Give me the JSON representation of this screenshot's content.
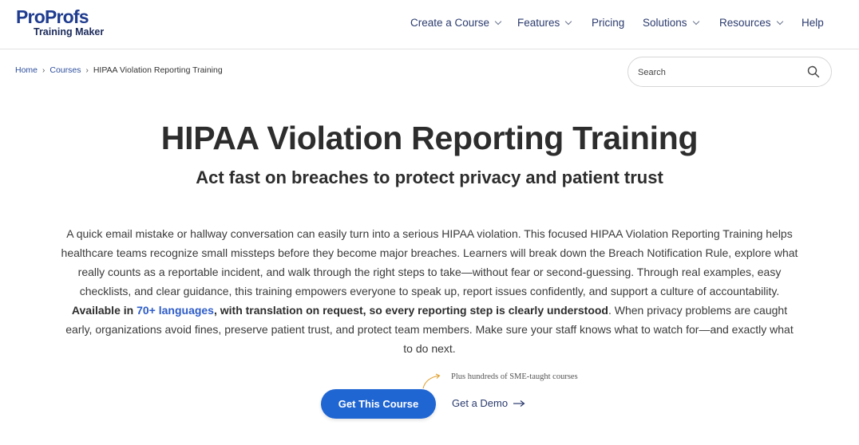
{
  "logo": {
    "top": "ProProfs",
    "sub": "Training Maker"
  },
  "nav": {
    "create": "Create a Course",
    "features": "Features",
    "pricing": "Pricing",
    "solutions": "Solutions",
    "resources": "Resources",
    "help": "Help"
  },
  "breadcrumb": {
    "home": "Home",
    "courses": "Courses",
    "current": "HIPAA Violation Reporting Training",
    "sep": "›"
  },
  "search": {
    "placeholder": "Search"
  },
  "hero": {
    "title": "HIPAA Violation Reporting Training",
    "subtitle": "Act fast on breaches to protect privacy and patient trust",
    "desc_part1": "A quick email mistake or hallway conversation can easily turn into a serious HIPAA violation. This focused HIPAA Violation Reporting Training helps healthcare teams recognize small missteps before they become major breaches. Learners will break down the Breach Notification Rule, explore what really counts as a reportable incident, and walk through the right steps to take—without fear or second-guessing. Through real examples, easy checklists, and clear guidance, this training empowers everyone to speak up, report issues confidently, and support a culture of accountability. ",
    "desc_bold1": "Available in ",
    "desc_lang": "70+ languages",
    "desc_bold2": ", with translation on request, so every reporting step is clearly understood",
    "desc_part2": ". When privacy problems are caught early, organizations avoid fines, preserve patient trust, and protect team members. Make sure your staff knows what to watch for—and exactly what to do next."
  },
  "cta": {
    "note": "Plus hundreds of SME-taught courses",
    "primary": "Get This Course",
    "demo": "Get a Demo"
  },
  "colors": {
    "primary": "#2066d3",
    "nav_text": "#2b3b6e",
    "link": "#2e4f9c"
  }
}
